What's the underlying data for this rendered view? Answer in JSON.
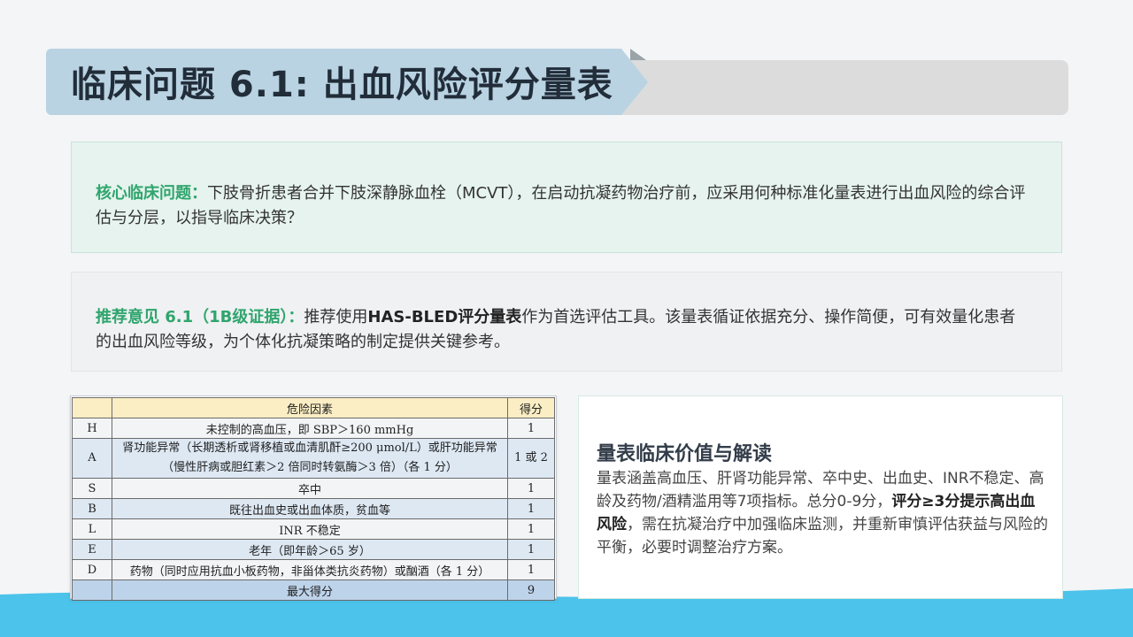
{
  "title": "临床问题 6.1: 出血风险评分量表",
  "core_question": {
    "label": "核心临床问题：",
    "text": "下肢骨折患者合并下肢深静脉血栓（MCVT），在启动抗凝药物治疗前，应采用何种标准化量表进行出血风险的综合评估与分层，以指导临床决策？"
  },
  "recommendation": {
    "label": "推荐意见 6.1（1B级证据）：",
    "text_before": "推荐使用",
    "bold": "HAS-BLED评分量表",
    "text_after": "作为首选评估工具。该量表循证依据充分、操作简便，可有效量化患者的出血风险等级，为个体化抗凝策略的制定提供关键参考。"
  },
  "table": {
    "headers": [
      "",
      "危险因素",
      "得分"
    ],
    "rows": [
      {
        "letter": "H",
        "factor": "未控制的高血压，即 SBP＞160 mmHg",
        "score": "1"
      },
      {
        "letter": "A",
        "factor": "肾功能异常（长期透析或肾移植或血清肌酐≥200 μmol/L）或肝功能异常（慢性肝病或胆红素＞2 倍同时转氨酶＞3 倍）（各 1 分）",
        "score": "1 或 2"
      },
      {
        "letter": "S",
        "factor": "卒中",
        "score": "1"
      },
      {
        "letter": "B",
        "factor": "既往出血史或出血体质，贫血等",
        "score": "1"
      },
      {
        "letter": "L",
        "factor": "INR 不稳定",
        "score": "1"
      },
      {
        "letter": "E",
        "factor": "老年（即年龄＞65 岁）",
        "score": "1"
      },
      {
        "letter": "D",
        "factor": "药物（同时应用抗血小板药物，非甾体类抗炎药物）或酗酒（各 1 分）",
        "score": "1"
      }
    ],
    "total_label": "最大得分",
    "total_score": "9"
  },
  "interpretation": {
    "title": "量表临床价值与解读",
    "text_before": "量表涵盖高血压、肝肾功能异常、卒中史、出血史、INR不稳定、高龄及药物/酒精滥用等7项指标。总分0-9分，",
    "bold": "评分≥3分提示高出血风险",
    "text_after": "，需在抗凝治疗中加强临床监测，并重新审慎评估获益与风险的平衡，必要时调整治疗方案。"
  },
  "colors": {
    "accent_green": "#2fa56d",
    "banner_blue": "#b9d3e2",
    "wave_blue": "#4cc3ea"
  }
}
